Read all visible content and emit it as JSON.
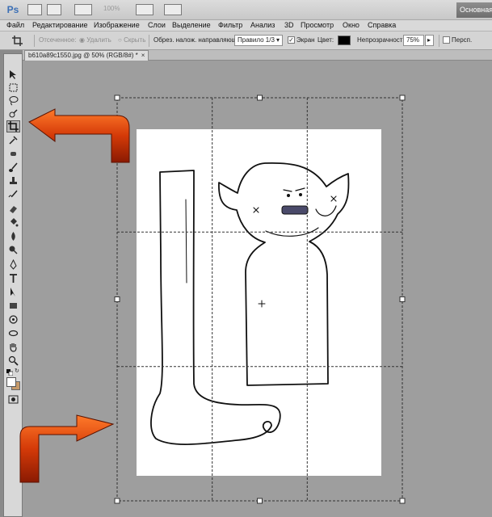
{
  "appbar": {
    "logo": "Ps",
    "zoom": "100%",
    "workspace": "Основная"
  },
  "menu": [
    "Файл",
    "Редактирование",
    "Изображение",
    "Слои",
    "Выделение",
    "Фильтр",
    "Анализ",
    "3D",
    "Просмотр",
    "Окно",
    "Справка"
  ],
  "options": {
    "cropped_label": "Отсеченное:",
    "delete_label": "Удалить",
    "hide_label": "Скрыть",
    "guide_label": "Обрез. налож. направляющ.:",
    "guide_value": "Правило 1/3",
    "shield_label": "Экран",
    "color_label": "Цвет:",
    "shield_color": "#000000",
    "opacity_label": "Непрозрачность:",
    "opacity_value": "75%",
    "perspective_label": "Персп."
  },
  "document": {
    "tab_title": "b610a89c1550.jpg @ 50% (RGB/8#) *",
    "close_glyph": "×"
  },
  "tools": [
    "move-icon",
    "marquee-icon",
    "lasso-icon",
    "quick-select-icon",
    "crop-icon",
    "eyedropper-icon",
    "spot-heal-icon",
    "brush-icon",
    "clone-stamp-icon",
    "history-brush-icon",
    "eraser-icon",
    "bucket-icon",
    "blur-icon",
    "dodge-icon",
    "pen-icon",
    "type-icon",
    "path-select-icon",
    "shape-icon",
    "3d-rotate-icon",
    "3d-orbit-icon",
    "hand-icon",
    "zoom-icon"
  ],
  "colors": {
    "foreground": "#1a1a1a",
    "background": "#ffffff",
    "arrow": "#d23a08"
  }
}
